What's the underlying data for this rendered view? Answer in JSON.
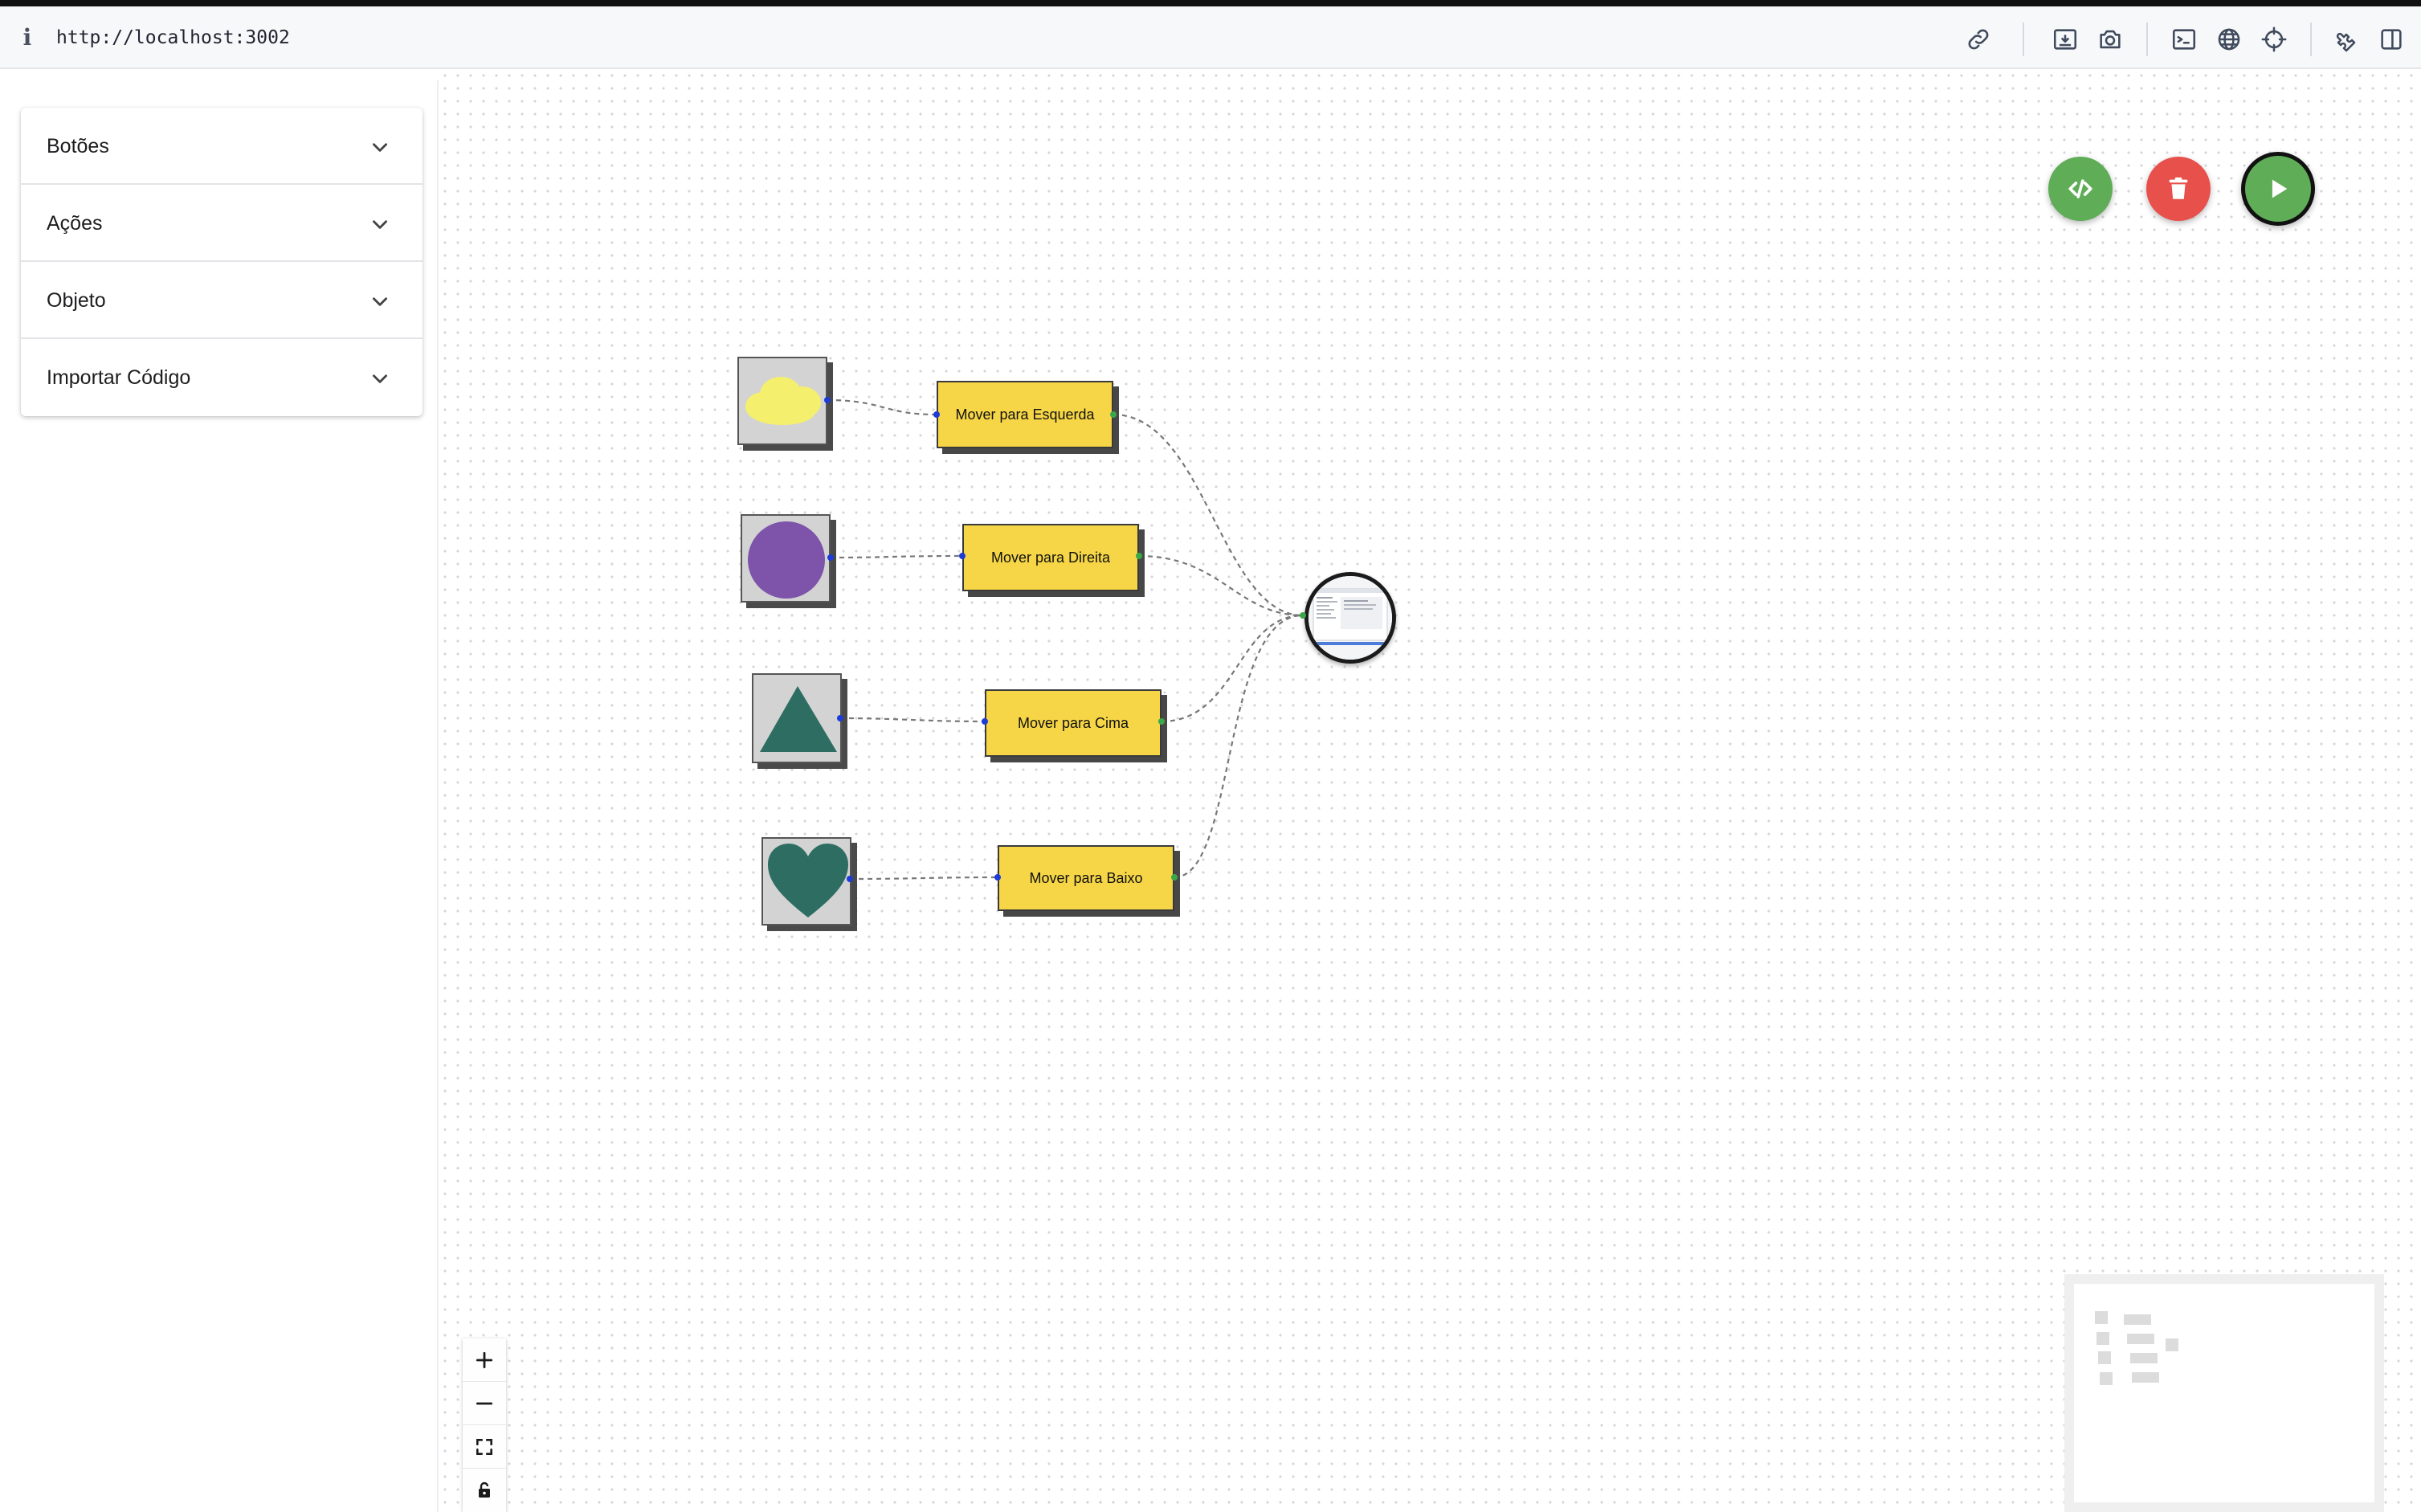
{
  "browser": {
    "url": "http://localhost:3002",
    "toolbar_icons": [
      "link-icon",
      "save-screenshot-icon",
      "camera-icon",
      "terminal-icon",
      "globe-icon",
      "crosshair-icon",
      "extensions-icon",
      "split-view-icon"
    ]
  },
  "sidebar": {
    "items": [
      {
        "label": "Botões"
      },
      {
        "label": "Ações"
      },
      {
        "label": "Objeto"
      },
      {
        "label": "Importar Código"
      }
    ]
  },
  "fab": {
    "code_color": "#5fad56",
    "delete_color": "#e8504b",
    "run_color": "#5fad56"
  },
  "nodes": {
    "shapes": [
      {
        "name": "cloud",
        "color": "#f4ef6d"
      },
      {
        "name": "circle",
        "color": "#7d54aa"
      },
      {
        "name": "triangle",
        "color": "#2e6e62"
      },
      {
        "name": "heart",
        "color": "#2e6e62"
      }
    ],
    "actions": [
      {
        "label": "Mover para Esquerda"
      },
      {
        "label": "Mover para Direita"
      },
      {
        "label": "Mover para Cima"
      },
      {
        "label": "Mover para Baixo"
      }
    ],
    "action_color": "#f6d646"
  },
  "zoom_controls": [
    "zoom-in-icon",
    "zoom-out-icon",
    "fit-view-icon",
    "lock-icon"
  ]
}
